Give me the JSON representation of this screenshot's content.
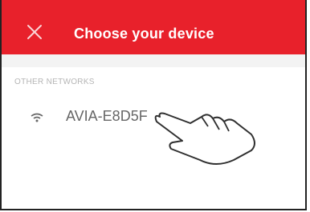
{
  "header": {
    "title": "Choose your device",
    "color": "#e8212b",
    "close_icon": "close-icon"
  },
  "list": {
    "section_label": "OTHER NETWORKS",
    "networks": [
      {
        "name": "AVIA-E8D5F",
        "icon": "wifi-icon"
      }
    ]
  },
  "overlay": {
    "icon": "pointing-hand-icon"
  }
}
